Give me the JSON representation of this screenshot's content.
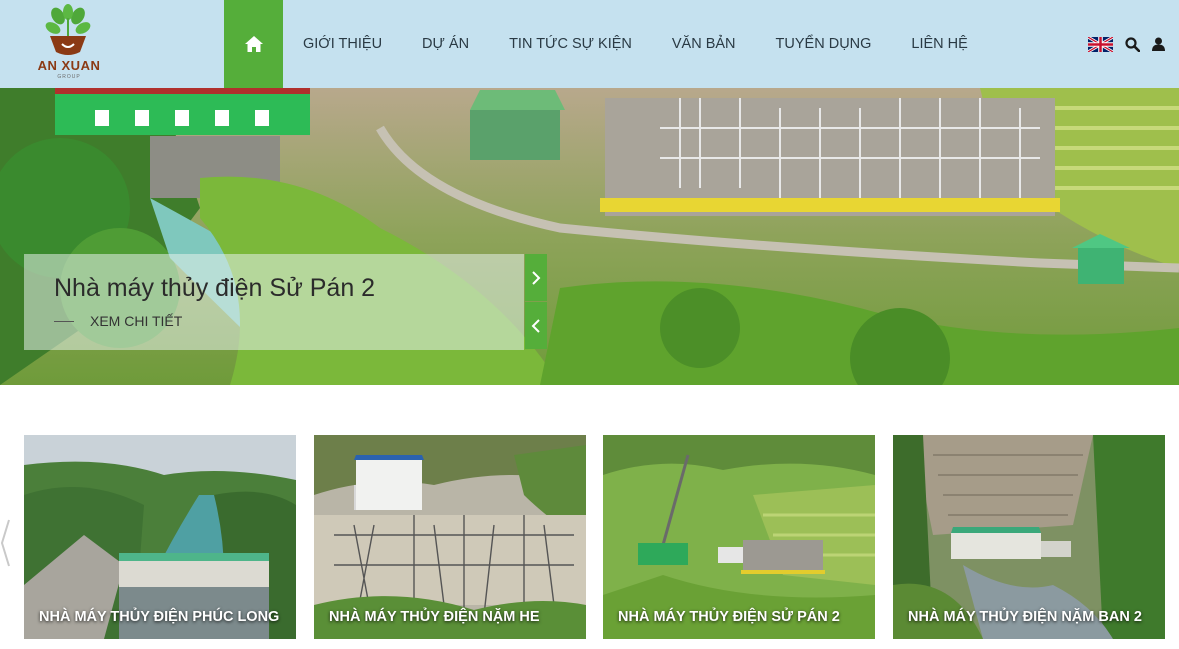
{
  "brand": {
    "name": "AN XUAN",
    "sub": "GROUP"
  },
  "nav": {
    "home_icon": "home-icon",
    "items": [
      "GIỚI THIỆU",
      "DỰ ÁN",
      "TIN TỨC SỰ KIỆN",
      "VĂN BẢN",
      "TUYỂN DỤNG",
      "LIÊN HỆ"
    ]
  },
  "tools": {
    "language_icon": "uk-flag-icon",
    "search_icon": "search-icon",
    "user_icon": "user-icon"
  },
  "hero": {
    "title": "Nhà máy thủy điện Sử Pán 2",
    "link": "XEM CHI TIẾT",
    "next_icon": "chevron-right-icon",
    "prev_icon": "chevron-left-icon"
  },
  "projects": [
    {
      "title": "NHÀ MÁY THỦY ĐIỆN PHÚC LONG"
    },
    {
      "title": "NHÀ MÁY THỦY ĐIỆN NẶM HE"
    },
    {
      "title": "NHÀ MÁY THỦY ĐIỆN SỬ PÁN 2"
    },
    {
      "title": "NHÀ MÁY THỦY ĐIỆN NẶM BAN 2"
    }
  ],
  "colors": {
    "header_bg": "#c5e1ef",
    "accent_green": "#55ae3a",
    "brand_brown": "#8b3a14"
  }
}
